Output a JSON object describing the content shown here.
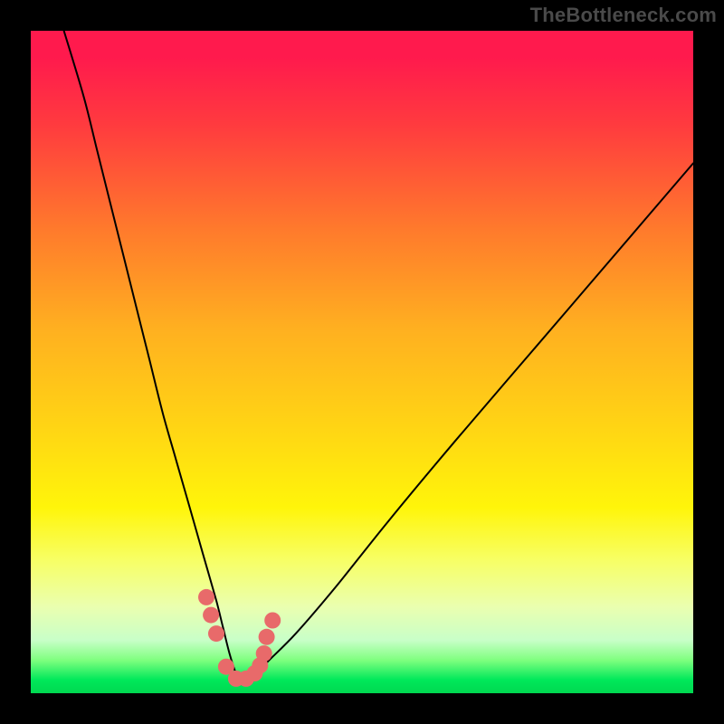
{
  "watermark": {
    "text": "TheBottleneck.com"
  },
  "chart_data": {
    "type": "line",
    "title": "",
    "xlabel": "",
    "ylabel": "",
    "xlim": [
      0,
      100
    ],
    "ylim": [
      0,
      100
    ],
    "series": [
      {
        "name": "bottleneck-curve",
        "x": [
          5,
          8,
          10,
          12,
          14,
          16,
          18,
          20,
          22,
          24,
          26,
          28,
          29,
          30,
          31,
          32,
          33,
          34,
          36,
          40,
          46,
          54,
          64,
          76,
          88,
          100
        ],
        "values": [
          100,
          90,
          82,
          74,
          66,
          58,
          50,
          42,
          35,
          28,
          21,
          14,
          10,
          6,
          3,
          2,
          2,
          3,
          5,
          9,
          16,
          26,
          38,
          52,
          66,
          80
        ]
      }
    ],
    "markers": {
      "name": "highlight-dots",
      "x": [
        26.5,
        27.2,
        28.0,
        29.5,
        31.0,
        32.5,
        33.8,
        34.6,
        35.2,
        35.6,
        36.5
      ],
      "values": [
        14.5,
        11.8,
        9.0,
        4.0,
        2.2,
        2.2,
        3.0,
        4.2,
        6.0,
        8.5,
        11.0
      ]
    },
    "colors": {
      "curve": "#000000",
      "markers": "#e86a6a",
      "gradient_top": "#ff1a4d",
      "gradient_mid": "#ffd514",
      "gradient_bottom": "#00d850"
    }
  }
}
